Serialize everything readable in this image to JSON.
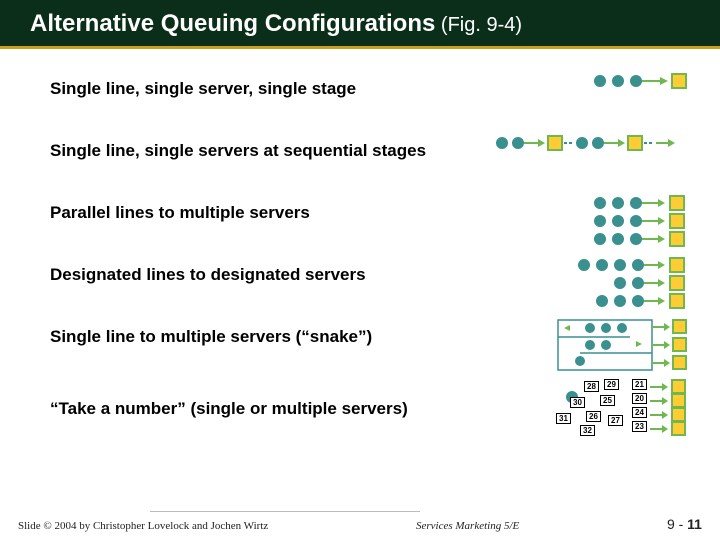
{
  "title_main": "Alternative Queuing Configurations",
  "title_suffix": " (Fig. 9-4)",
  "rows": [
    {
      "text": "Single line, single server, single stage"
    },
    {
      "text": "Single line, single servers at sequential stages"
    },
    {
      "text": "Parallel lines to multiple servers"
    },
    {
      "text": "Designated lines to designated servers"
    },
    {
      "text": "Single line to multiple servers (“snake”)"
    },
    {
      "text": "“Take a number” (single or multiple servers)"
    }
  ],
  "tickets": [
    "28",
    "29",
    "30",
    "25",
    "31",
    "26",
    "32",
    "27",
    "21",
    "20",
    "24",
    "23"
  ],
  "footer": {
    "left": "Slide © 2004 by Christopher Lovelock and Jochen Wirtz",
    "mid": "Services Marketing 5/E",
    "right_prefix": "9 -  ",
    "right_num": "11"
  },
  "colors": {
    "teal": "#3a8f8f",
    "green": "#6fb84f",
    "dotfill": "#3a8f8f",
    "server": "#ffcc33",
    "serverStroke": "#6fb84f"
  }
}
